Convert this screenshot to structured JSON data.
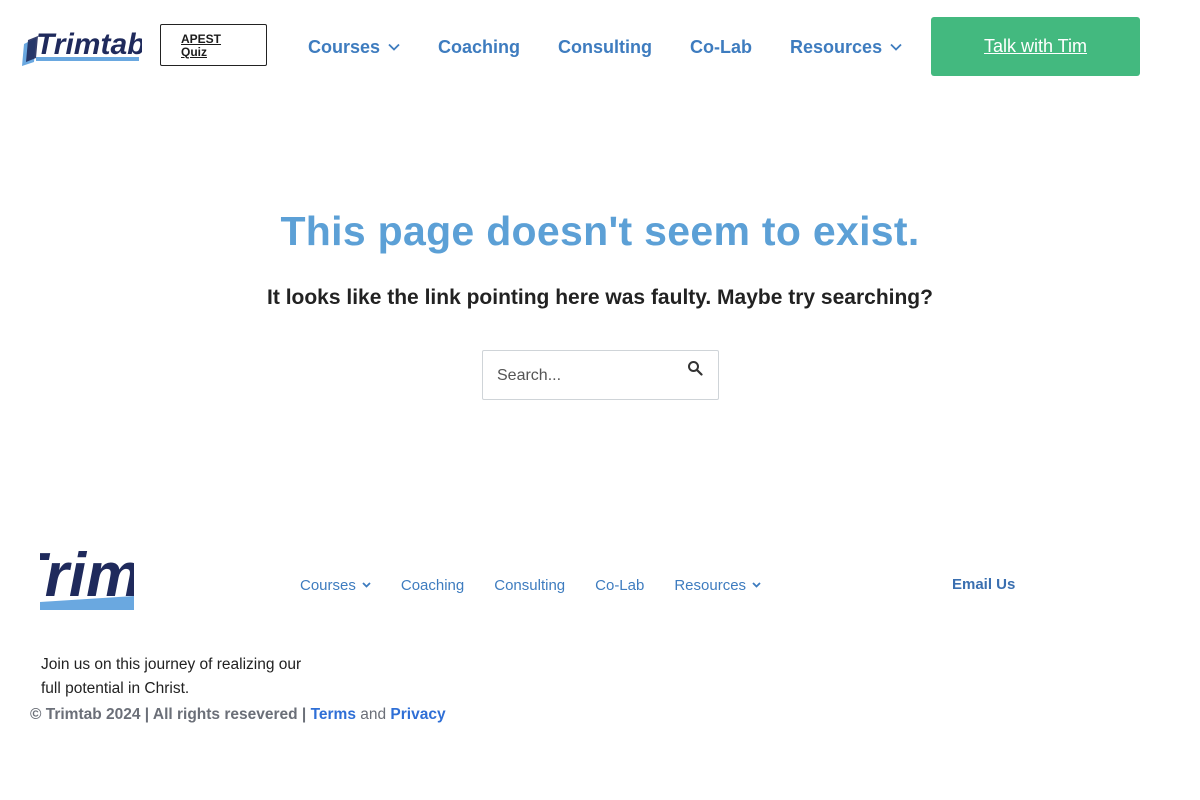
{
  "header": {
    "logo_text": "Trimtab",
    "apest_button": {
      "line1": "APEST",
      "line2": "Quiz"
    },
    "nav": [
      {
        "label": "Courses",
        "dropdown": true
      },
      {
        "label": "Coaching",
        "dropdown": false
      },
      {
        "label": "Consulting",
        "dropdown": false
      },
      {
        "label": "Co-Lab",
        "dropdown": false
      },
      {
        "label": "Resources",
        "dropdown": true
      }
    ],
    "cta_label": "Talk with Tim"
  },
  "main": {
    "title": "This page doesn't seem to exist.",
    "subtitle": "It looks like the link pointing here was faulty. Maybe try searching?",
    "search": {
      "placeholder": "Search...",
      "value": ""
    }
  },
  "footer": {
    "logo_text": "Trimtab",
    "nav": [
      {
        "label": "Courses",
        "dropdown": true
      },
      {
        "label": "Coaching",
        "dropdown": false
      },
      {
        "label": "Consulting",
        "dropdown": false
      },
      {
        "label": "Co-Lab",
        "dropdown": false
      },
      {
        "label": "Resources",
        "dropdown": true
      }
    ],
    "email_label": "Email Us",
    "tagline": "Join us on this journey of realizing our full potential in Christ.",
    "copyright_prefix": "© Trimtab 2024 | All rights resevered | ",
    "terms_label": "Terms",
    "and_label": " and ",
    "privacy_label": "Privacy"
  },
  "colors": {
    "brand_blue": "#3e7cbf",
    "title_blue": "#5ca0d6",
    "logo_navy": "#1f2a5c",
    "logo_light_blue": "#6aa8e0",
    "cta_green": "#43b97f",
    "link_blue": "#2f6fd6"
  }
}
